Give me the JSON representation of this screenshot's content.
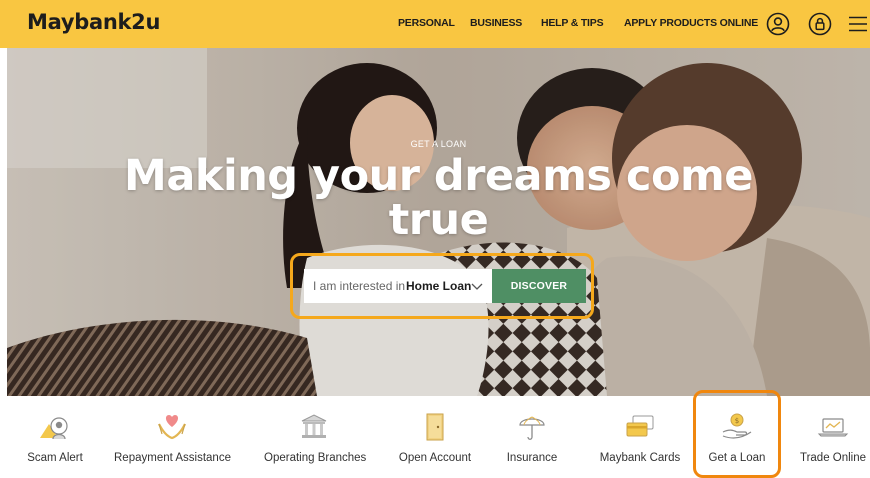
{
  "header": {
    "logo": "Maybank2u",
    "nav": [
      "PERSONAL",
      "BUSINESS",
      "HELP & TIPS",
      "APPLY PRODUCTS ONLINE"
    ],
    "icons": [
      "user-icon",
      "lock-icon",
      "menu-icon"
    ],
    "brand_color": "#f9c641"
  },
  "hero": {
    "eyebrow": "GET A LOAN",
    "headline_line1": "Making your dreams come",
    "headline_line2": "true",
    "picker_prefix": "I am interested in",
    "picker_value": "Home Loan",
    "discover_label": "DISCOVER",
    "discover_color": "#4f8f64"
  },
  "quick_links": [
    {
      "label": "Scam Alert",
      "icon": "scam-alert-icon"
    },
    {
      "label": "Repayment Assistance",
      "icon": "heart-hands-icon"
    },
    {
      "label": "Operating Branches",
      "icon": "bank-building-icon"
    },
    {
      "label": "Open Account",
      "icon": "door-icon"
    },
    {
      "label": "Insurance",
      "icon": "umbrella-icon"
    },
    {
      "label": "Maybank Cards",
      "icon": "cards-icon"
    },
    {
      "label": "Get a Loan",
      "icon": "coin-hand-icon"
    },
    {
      "label": "Trade Online",
      "icon": "laptop-icon"
    }
  ],
  "highlight_colors": {
    "selector": "#f5a81c",
    "loan": "#f0870e"
  }
}
